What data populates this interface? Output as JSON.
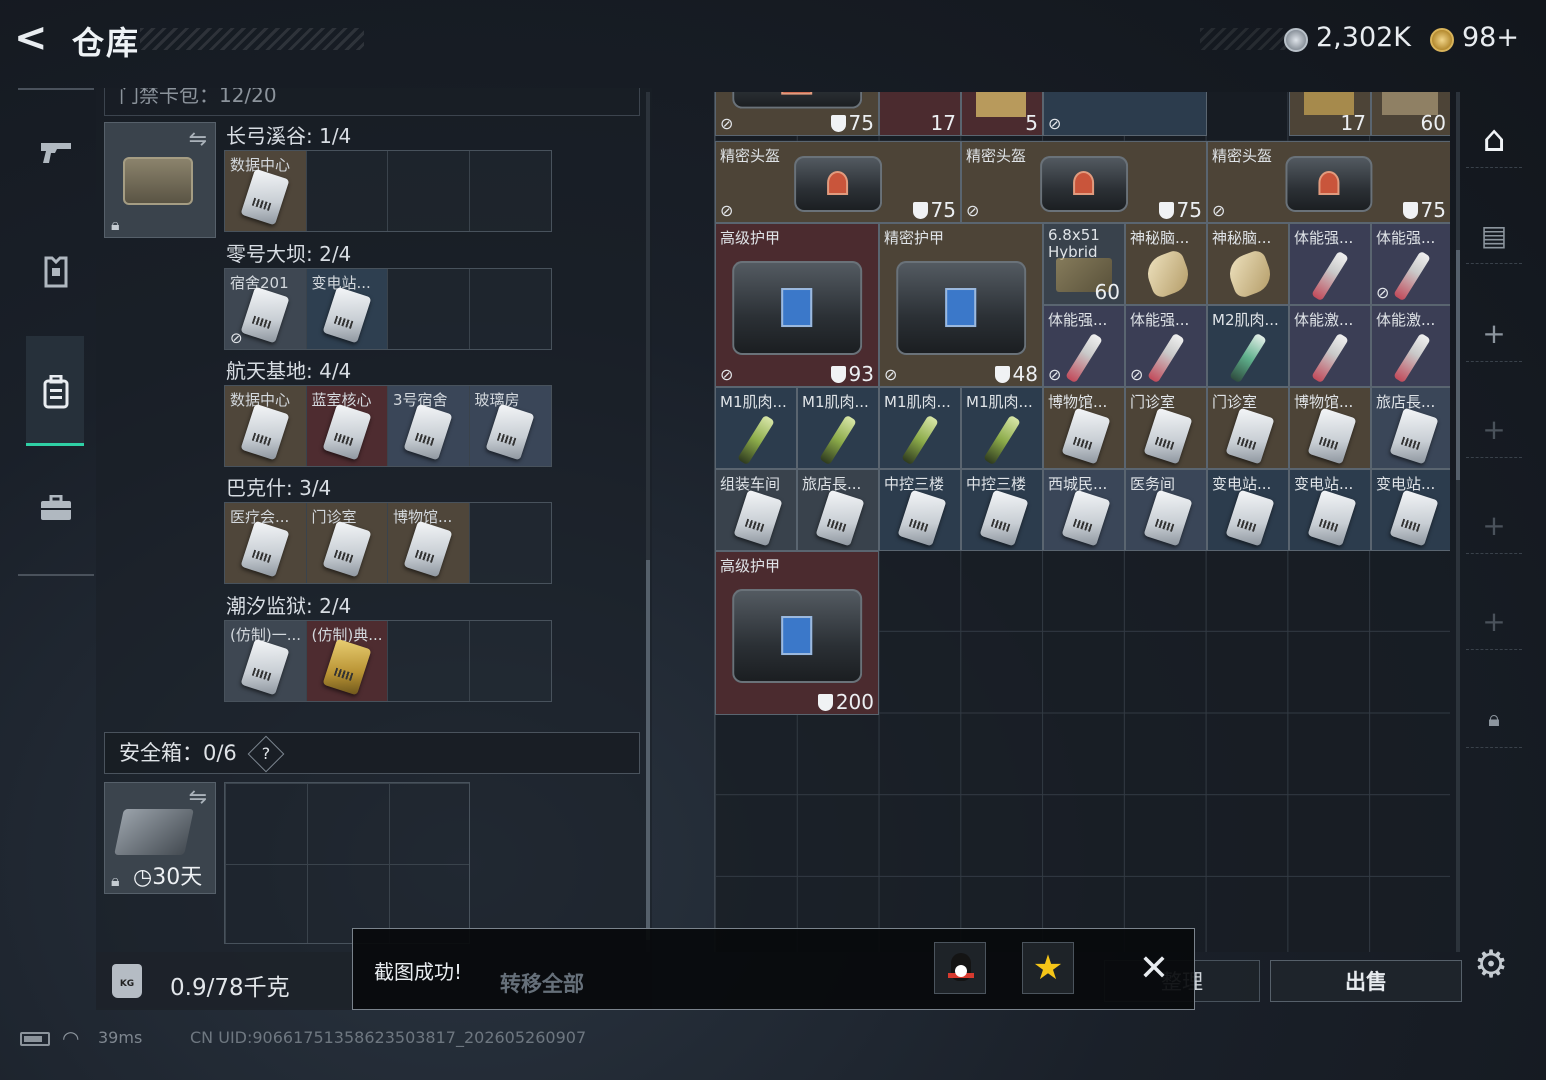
{
  "header": {
    "back": "<",
    "title": "仓库",
    "money": "2,302K",
    "coins": "98+"
  },
  "left_nav": {
    "icons": [
      "gun-icon",
      "armor-icon",
      "backpack-icon",
      "briefcase-icon"
    ]
  },
  "key_pack": {
    "header_label": "门禁卡包：12/20",
    "regions": [
      {
        "label": "长弓溪谷: 1/4",
        "cells": [
          "数据中心",
          "",
          "",
          ""
        ]
      },
      {
        "label": "零号大坝: 2/4",
        "cells": [
          "宿舍201",
          "变电站...",
          "",
          ""
        ]
      },
      {
        "label": "航天基地: 4/4",
        "cells": [
          "数据中心",
          "蓝室核心",
          "3号宿舍",
          "玻璃房"
        ]
      },
      {
        "label": "巴克什: 3/4",
        "cells": [
          "医疗会...",
          "门诊室",
          "博物馆...",
          ""
        ]
      },
      {
        "label": "潮汐监狱: 2/4",
        "cells": [
          "(仿制)一...",
          "(仿制)典...",
          "",
          ""
        ]
      }
    ]
  },
  "safe_box": {
    "label": "安全箱：0/6",
    "help": "?",
    "expiry": "30天"
  },
  "weight": {
    "value": "0.9/78千克",
    "icon_label": "KG"
  },
  "storage": {
    "top_row_values": [
      "75",
      "17",
      "5",
      "17",
      "60"
    ],
    "items": [
      {
        "id": "helmet1",
        "label": "精密头盔",
        "value": "75"
      },
      {
        "id": "helmet2",
        "label": "精密头盔",
        "value": "75"
      },
      {
        "id": "helmet3",
        "label": "精密头盔",
        "value": "75"
      },
      {
        "id": "armor1",
        "label": "高级护甲",
        "value": "93"
      },
      {
        "id": "armor2",
        "label": "精密护甲",
        "value": "48"
      },
      {
        "id": "ammo1",
        "label": "6.8x51 Hybrid",
        "value": "60"
      },
      {
        "id": "brain1",
        "label": "神秘脑..."
      },
      {
        "id": "brain2",
        "label": "神秘脑..."
      },
      {
        "id": "syr1",
        "label": "体能强..."
      },
      {
        "id": "syr2",
        "label": "体能强..."
      },
      {
        "id": "syr3",
        "label": "体能强..."
      },
      {
        "id": "syr4",
        "label": "体能强..."
      },
      {
        "id": "syr5",
        "label": "M2肌肉..."
      },
      {
        "id": "syr6",
        "label": "体能激..."
      },
      {
        "id": "syr7",
        "label": "体能激..."
      },
      {
        "id": "m1a",
        "label": "M1肌肉..."
      },
      {
        "id": "m1b",
        "label": "M1肌肉..."
      },
      {
        "id": "m1c",
        "label": "M1肌肉..."
      },
      {
        "id": "m1d",
        "label": "M1肌肉..."
      },
      {
        "id": "k1",
        "label": "博物馆..."
      },
      {
        "id": "k2",
        "label": "门诊室"
      },
      {
        "id": "k3",
        "label": "门诊室"
      },
      {
        "id": "k4",
        "label": "博物馆..."
      },
      {
        "id": "k5",
        "label": "旅店長..."
      },
      {
        "id": "k6",
        "label": "组装车间"
      },
      {
        "id": "k7",
        "label": "旅店長..."
      },
      {
        "id": "k8",
        "label": "中控三楼"
      },
      {
        "id": "k9",
        "label": "中控三楼"
      },
      {
        "id": "k10",
        "label": "西城民..."
      },
      {
        "id": "k11",
        "label": "医务间"
      },
      {
        "id": "k12",
        "label": "变电站..."
      },
      {
        "id": "k13",
        "label": "变电站..."
      },
      {
        "id": "k14",
        "label": "变电站..."
      },
      {
        "id": "armor3",
        "label": "高级护甲",
        "value": "200"
      }
    ]
  },
  "actions": {
    "transfer_all": "转移全部",
    "sort": "整理",
    "sell": "出售"
  },
  "toast": {
    "message": "截图成功!",
    "close": "✕"
  },
  "status": {
    "ping": "39ms",
    "uid": "CN UID:906617513586235038​17_202605260907"
  },
  "colors": {
    "accent": "#2fd0a5",
    "item_brown": "#4d4437",
    "item_red": "#4b2b2f",
    "item_blue": "#2c3c4d"
  }
}
